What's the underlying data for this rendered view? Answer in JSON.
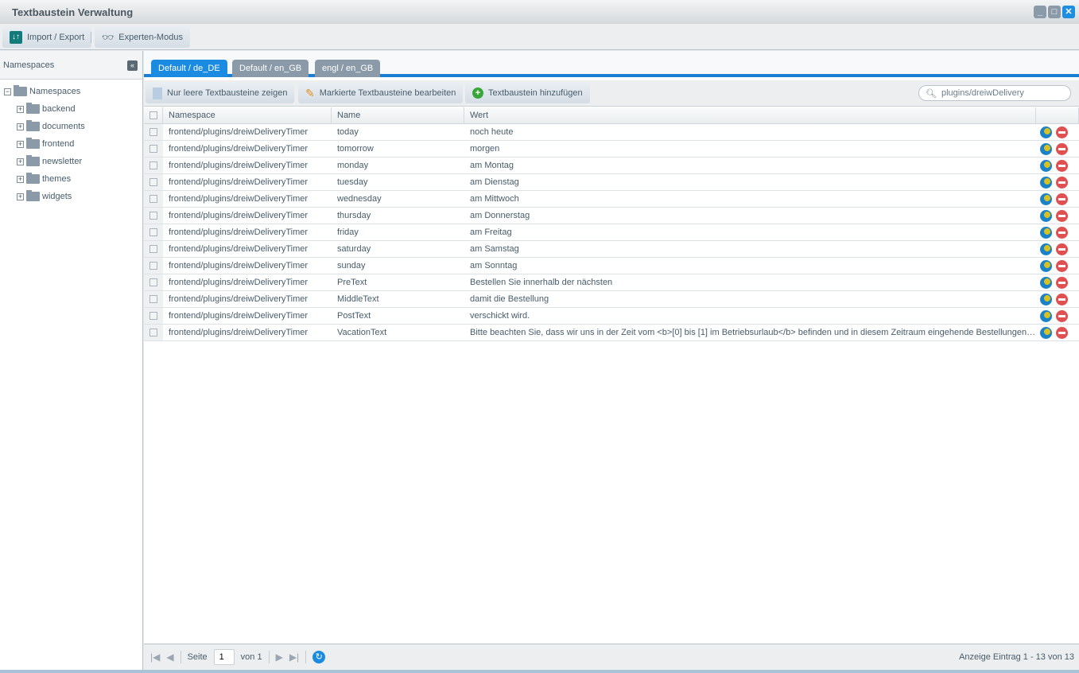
{
  "window": {
    "title": "Textbaustein Verwaltung",
    "controls": [
      "minimize",
      "maximize",
      "close"
    ]
  },
  "toolbar": {
    "import_export": "Import / Export",
    "expert_mode": "Experten-Modus"
  },
  "sidebar": {
    "title": "Namespaces",
    "root": "Namespaces",
    "items": [
      "backend",
      "documents",
      "frontend",
      "newsletter",
      "themes",
      "widgets"
    ]
  },
  "tabs": [
    {
      "label": "Default / de_DE",
      "active": true
    },
    {
      "label": "Default / en_GB"
    },
    {
      "label": "engl / en_GB"
    }
  ],
  "grid_toolbar": {
    "empty_only": "Nur leere Textbausteine zeigen",
    "edit_marked": "Markierte Textbausteine bearbeiten",
    "add": "Textbaustein hinzufügen",
    "search_value": "plugins/dreiwDelivery"
  },
  "columns": [
    "Namespace",
    "Name",
    "Wert"
  ],
  "rows": [
    [
      "frontend/plugins/dreiwDeliveryTimer",
      "today",
      "noch heute"
    ],
    [
      "frontend/plugins/dreiwDeliveryTimer",
      "tomorrow",
      "morgen"
    ],
    [
      "frontend/plugins/dreiwDeliveryTimer",
      "monday",
      "am Montag"
    ],
    [
      "frontend/plugins/dreiwDeliveryTimer",
      "tuesday",
      "am Dienstag"
    ],
    [
      "frontend/plugins/dreiwDeliveryTimer",
      "wednesday",
      "am Mittwoch"
    ],
    [
      "frontend/plugins/dreiwDeliveryTimer",
      "thursday",
      "am Donnerstag"
    ],
    [
      "frontend/plugins/dreiwDeliveryTimer",
      "friday",
      "am Freitag"
    ],
    [
      "frontend/plugins/dreiwDeliveryTimer",
      "saturday",
      "am Samstag"
    ],
    [
      "frontend/plugins/dreiwDeliveryTimer",
      "sunday",
      "am Sonntag"
    ],
    [
      "frontend/plugins/dreiwDeliveryTimer",
      "PreText",
      "Bestellen Sie innerhalb der nächsten"
    ],
    [
      "frontend/plugins/dreiwDeliveryTimer",
      "MiddleText",
      "damit die Bestellung"
    ],
    [
      "frontend/plugins/dreiwDeliveryTimer",
      "PostText",
      "verschickt wird."
    ],
    [
      "frontend/plugins/dreiwDeliveryTimer",
      "VacationText",
      "Bitte beachten Sie, dass wir uns in der Zeit vom <b>[0] bis [1] im Betriebsurlaub</b> befinden und in diesem Zeitraum eingehende Bestellungen erst nach unserem Urlaub bearbeiten können."
    ]
  ],
  "pager": {
    "page_label": "Seite",
    "page": "1",
    "of_label": "von 1",
    "status": "Anzeige Eintrag 1 - 13 von 13"
  }
}
